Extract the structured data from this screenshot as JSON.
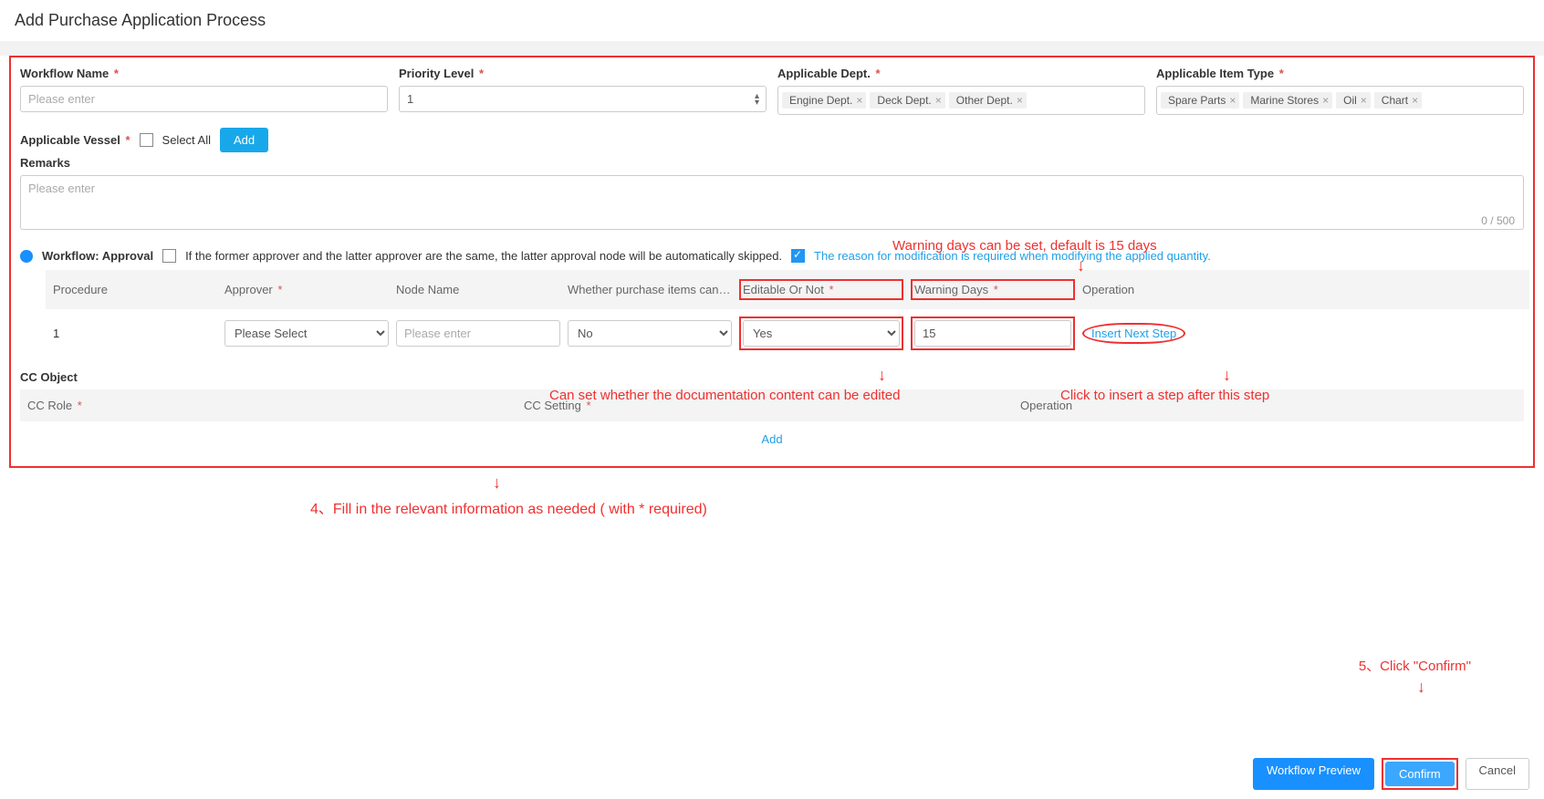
{
  "page_title": "Add Purchase Application Process",
  "fields": {
    "workflow_name": {
      "label": "Workflow Name",
      "placeholder": "Please enter"
    },
    "priority_level": {
      "label": "Priority Level",
      "value": "1"
    },
    "applicable_dept": {
      "label": "Applicable Dept.",
      "tags": [
        "Engine Dept.",
        "Deck Dept.",
        "Other Dept."
      ]
    },
    "applicable_item_type": {
      "label": "Applicable Item Type",
      "tags": [
        "Spare Parts",
        "Marine Stores",
        "Oil",
        "Chart"
      ]
    },
    "applicable_vessel": {
      "label": "Applicable Vessel",
      "select_all_label": "Select All",
      "add_label": "Add"
    },
    "remarks": {
      "label": "Remarks",
      "placeholder": "Please enter",
      "counter": "0 / 500"
    }
  },
  "workflow": {
    "title": "Workflow: Approval",
    "skip_note": "If the former approver and the latter approver are the same, the latter approval node will be automatically skipped.",
    "reason_note": "The reason for modification is required when modifying the applied quantity.",
    "headers": {
      "procedure": "Procedure",
      "approver": "Approver",
      "node_name": "Node Name",
      "purchase_editable": "Whether purchase items can be…",
      "editable_or_not": "Editable Or Not",
      "warning_days": "Warning Days",
      "operation": "Operation"
    },
    "row": {
      "procedure": "1",
      "approver_placeholder": "Please Select",
      "node_placeholder": "Please enter",
      "purchase_value": "No",
      "editable_value": "Yes",
      "warning_value": "15",
      "insert_label": "Insert Next Step"
    }
  },
  "cc": {
    "title": "CC Object",
    "headers": {
      "role": "CC Role",
      "setting": "CC Setting",
      "operation": "Operation"
    },
    "add_label": "Add"
  },
  "annotations": {
    "warning_days": "Warning days can be set, default is 15 days",
    "editable_doc": "Can set whether the documentation content can be edited",
    "insert_step": "Click to insert a step after this step",
    "fill_info": "4、Fill in the relevant information as needed ( with * required)",
    "click_confirm": "5、Click \"Confirm\""
  },
  "footer": {
    "preview": "Workflow Preview",
    "confirm": "Confirm",
    "cancel": "Cancel"
  }
}
